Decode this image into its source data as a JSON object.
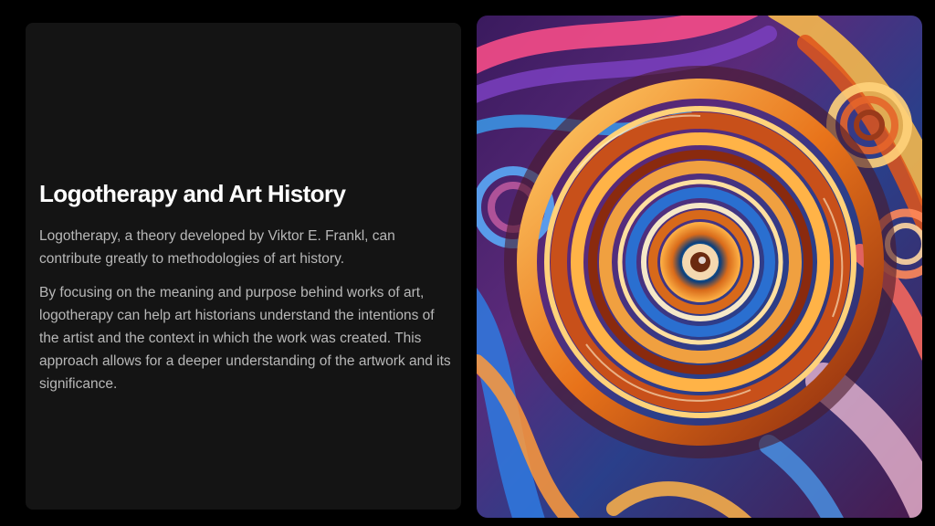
{
  "slide": {
    "title": "Logotherapy and Art History",
    "paragraphs": [
      "Logotherapy, a theory developed by Viktor E. Frankl, can contribute greatly to methodologies of art history.",
      "By focusing on the meaning and purpose behind works of art, logotherapy can help art historians understand the intentions of the artist and the context in which the work was created. This approach allows for a deeper understanding of the artwork and its significance."
    ]
  },
  "colors": {
    "background": "#000000",
    "card": "#141414",
    "title_text": "#ffffff",
    "body_text": "#b8b8b8"
  }
}
